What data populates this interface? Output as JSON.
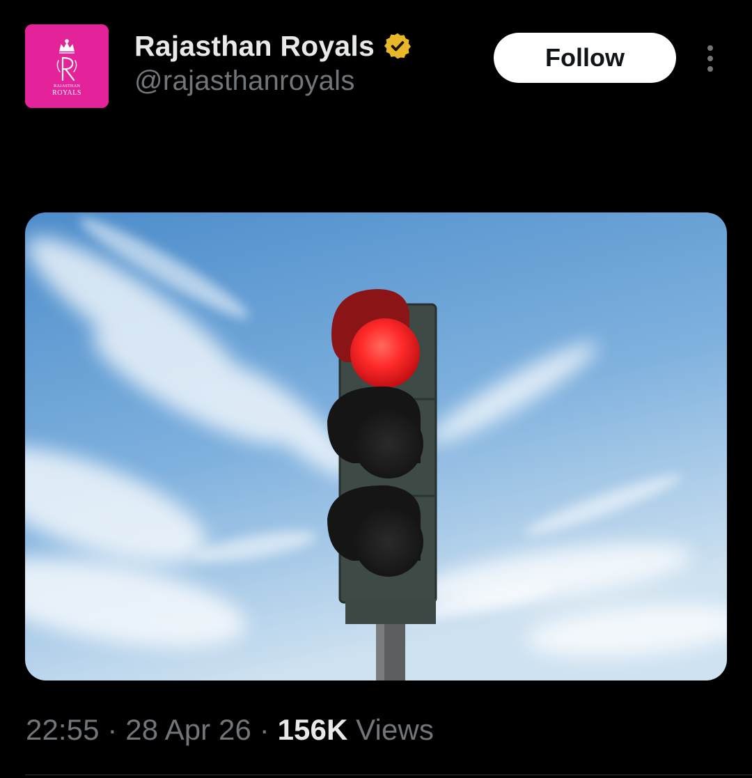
{
  "author": {
    "name": "Rajasthan Royals",
    "handle": "@rajasthanroyals",
    "verified_icon": "verified-badge-gold-icon",
    "avatar": {
      "background": "#e4239b",
      "logo_text_top": "RAJASTHAN",
      "logo_text_bottom": "ROYALS"
    }
  },
  "actions": {
    "follow_label": "Follow",
    "more_icon": "more-vertical-icon"
  },
  "media": {
    "subject": "traffic-light-red",
    "colors": {
      "sky_top": "#5a96cf",
      "sky_bottom": "#c4dcef",
      "red_light": "#ff2a2a"
    }
  },
  "meta": {
    "time": "22:55",
    "sep1": " · ",
    "date": "28 Apr 26",
    "sep2": " · ",
    "views_count": "156K",
    "views_label": " Views"
  }
}
